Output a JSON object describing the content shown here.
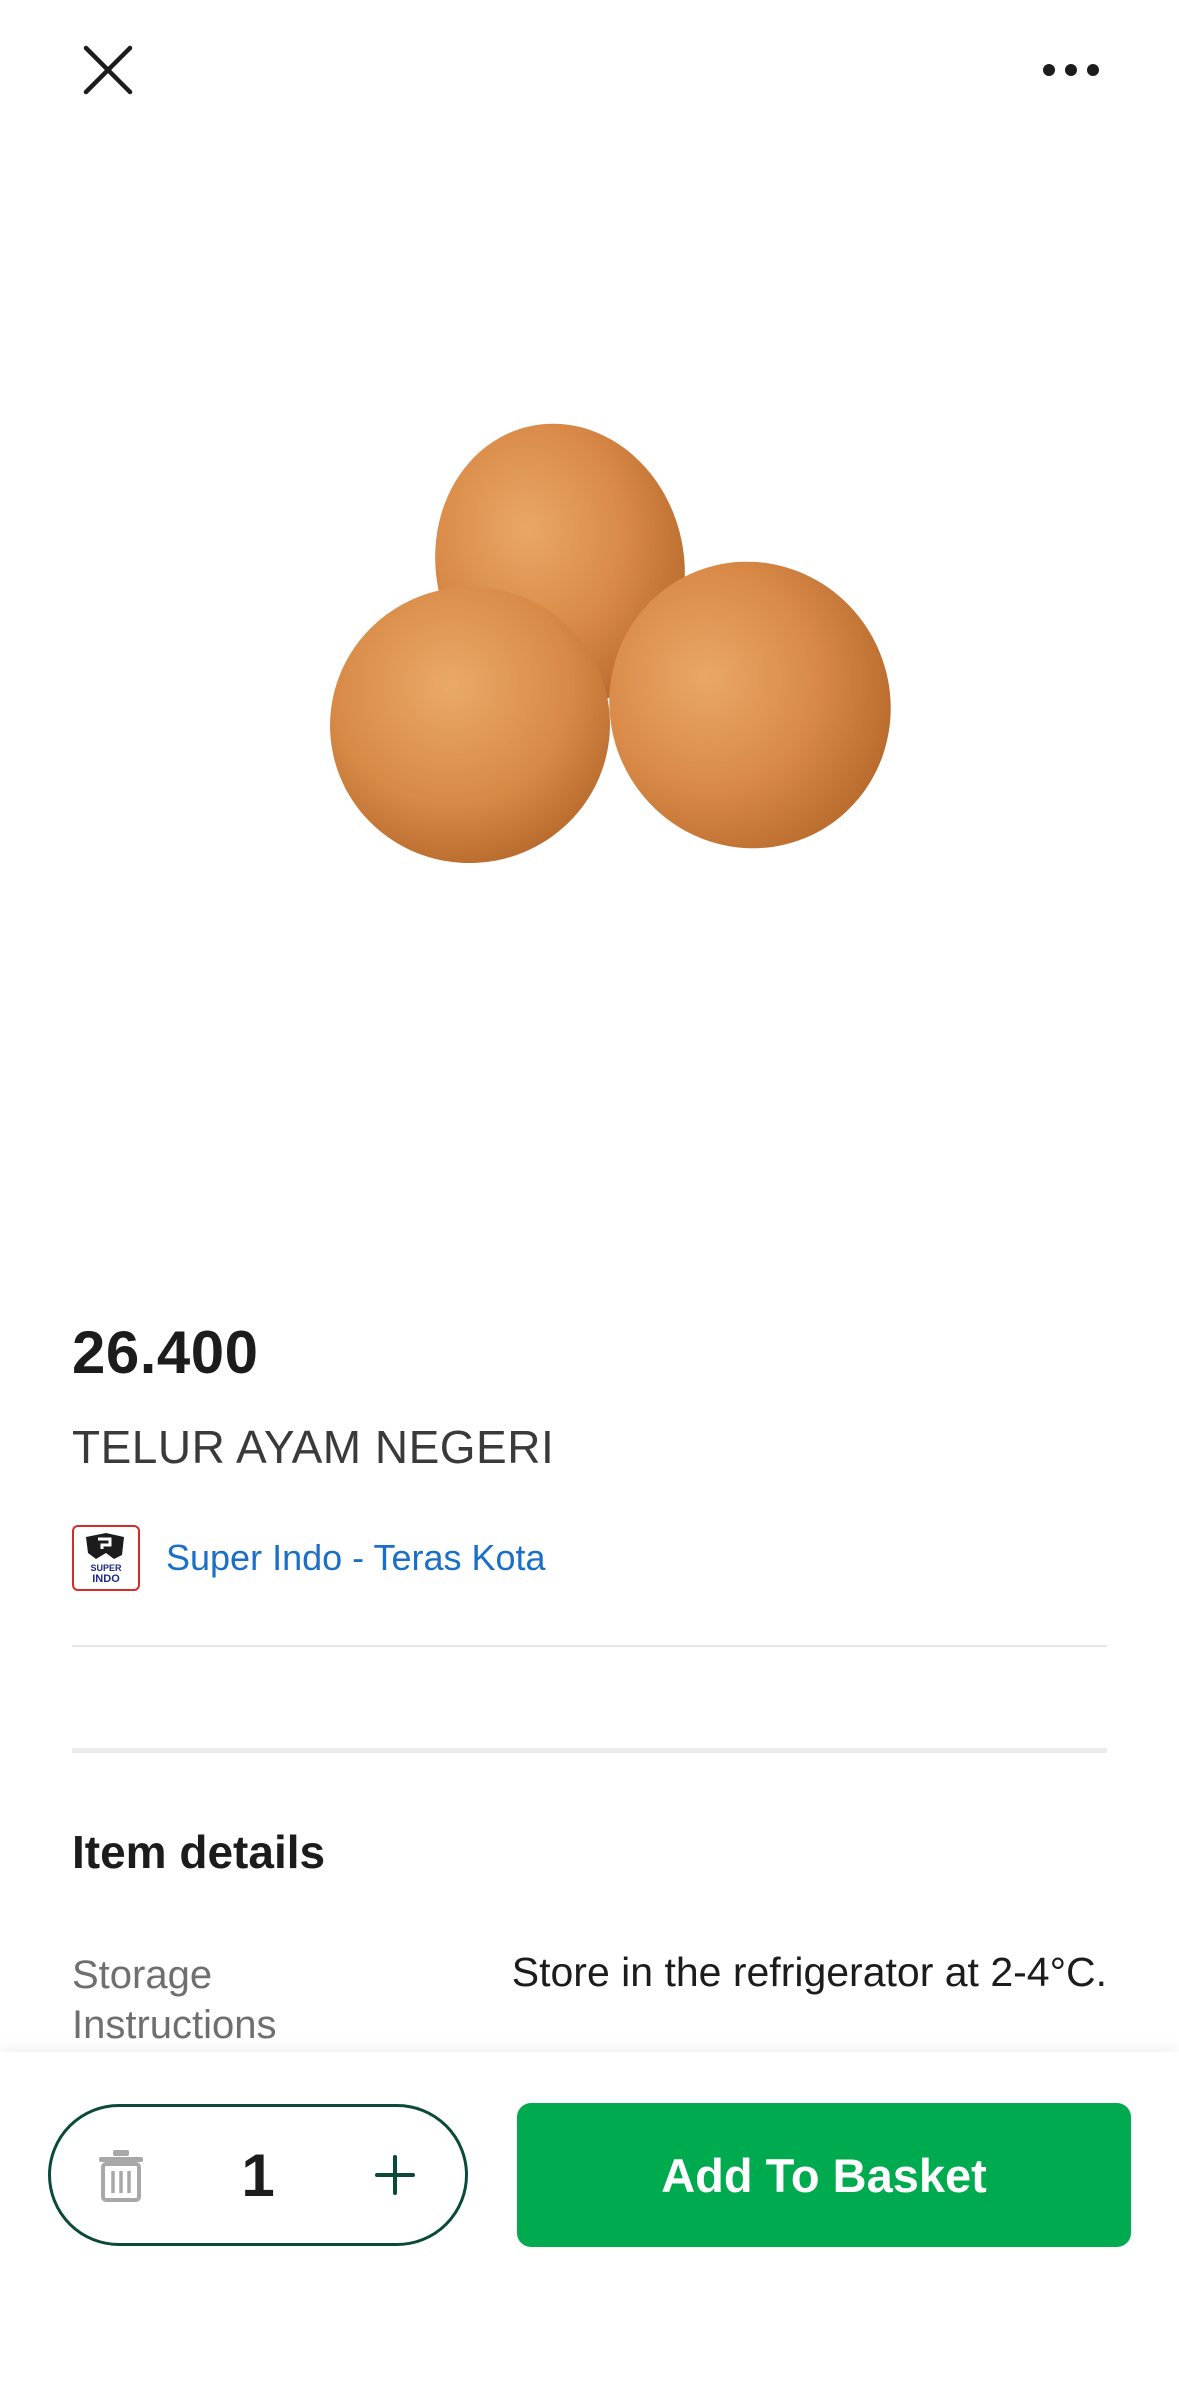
{
  "header": {
    "close_icon": "close-icon",
    "more_icon": "more-horizontal-icon"
  },
  "product": {
    "image": "brown-eggs-image",
    "price": "26.400",
    "name": "TELUR AYAM NEGERI"
  },
  "store": {
    "logo": "super-indo-logo",
    "logo_text_top": "SUPER",
    "logo_text_bottom": "INDO",
    "name": "Super Indo - Teras Kota"
  },
  "details": {
    "title": "Item details",
    "rows": [
      {
        "label": "Storage Instructions",
        "value": "Store in the refrigerator at 2-4°C."
      }
    ]
  },
  "cart": {
    "delete_icon": "trash-icon",
    "quantity": "1",
    "plus_icon": "plus-icon",
    "add_button_label": "Add To Basket"
  },
  "colors": {
    "accent_green": "#00aa4f",
    "stepper_border": "#0b4a3a",
    "store_link": "#1a6fc7",
    "logo_red": "#d62b2b"
  }
}
